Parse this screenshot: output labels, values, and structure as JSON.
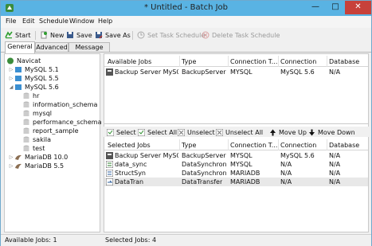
{
  "window": {
    "title": "* Untitled - Batch Job",
    "close_glyph": "✕",
    "max_glyph": "□",
    "min_glyph": "—"
  },
  "menu": [
    "File",
    "Edit",
    "Schedule",
    "Window",
    "Help"
  ],
  "toolbar": {
    "start": "Start",
    "new": "New",
    "save": "Save",
    "save_as": "Save As",
    "set_task": "Set Task Schedule",
    "delete_task": "Delete Task Schedule"
  },
  "tabs": [
    "General",
    "Advanced",
    "Message Log"
  ],
  "tree": {
    "root": "Navicat",
    "connections": [
      {
        "name": "MySQL 5.1",
        "type": "mysql",
        "expanded": false
      },
      {
        "name": "MySQL 5.5",
        "type": "mysql",
        "expanded": false
      },
      {
        "name": "MySQL 5.6",
        "type": "mysql",
        "expanded": true
      }
    ],
    "databases": [
      "hr",
      "information_schema",
      "mysql",
      "performance_schema",
      "report_sample",
      "sakila",
      "test"
    ],
    "other": [
      {
        "name": "MariaDB 10.0",
        "type": "mariadb"
      },
      {
        "name": "MariaDB 5.5",
        "type": "mariadb"
      }
    ]
  },
  "available": {
    "headers": [
      "Available Jobs",
      "Type",
      "Connection T...",
      "Connection",
      "Database"
    ],
    "rows": [
      [
        "Backup Server MySQ...",
        "BackupServer",
        "MYSQL",
        "MySQL 5.6",
        "N/A"
      ]
    ]
  },
  "actions": {
    "select": "Select",
    "select_all": "Select All",
    "unselect": "Unselect",
    "unselect_all": "Unselect All",
    "move_up": "Move Up",
    "move_down": "Move Down"
  },
  "selected": {
    "headers": [
      "Selected Jobs",
      "Type",
      "Connection T...",
      "Connection",
      "Database"
    ],
    "rows": [
      [
        "Backup Server MySQ...",
        "BackupServer",
        "MYSQL",
        "MySQL 5.6",
        "N/A"
      ],
      [
        "data_sync",
        "DataSynchron...",
        "MYSQL",
        "N/A",
        "N/A"
      ],
      [
        "StructSyn",
        "DataSynchron...",
        "MARIADB",
        "N/A",
        "N/A"
      ],
      [
        "DataTran",
        "DataTransfer",
        "MARIADB",
        "N/A",
        "N/A"
      ]
    ]
  },
  "status": {
    "available": "Available Jobs: 1",
    "selected": "Selected Jobs: 4"
  },
  "colors": {
    "titlebar": "#59b3e3",
    "close": "#c7413a",
    "mysql_icon": "#3b8fd1",
    "mariadb_icon": "#8b6e52",
    "start_icon": "#2e9e2e",
    "arrow_icon": "#2aa02a"
  }
}
